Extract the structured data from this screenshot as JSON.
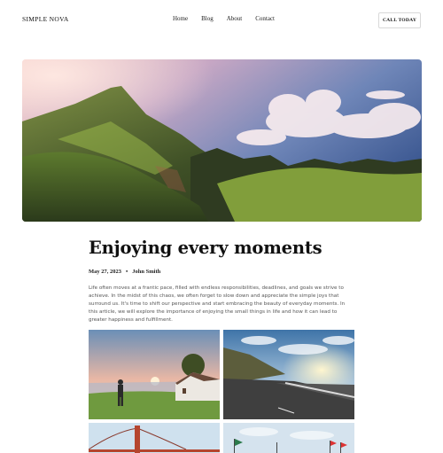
{
  "header": {
    "brand": "SIMPLE NOVA",
    "nav": [
      "Home",
      "Blog",
      "About",
      "Contact"
    ],
    "cta": "CALL TODAY"
  },
  "hero": {
    "image": "mountain-valley-sunset-photo"
  },
  "article": {
    "title": "Enjoying every moments",
    "date": "May 27, 2023",
    "separator": "•",
    "author": "John Smith",
    "body": "Life often moves at a frantic pace, filled with endless responsibilities, deadlines, and goals we strive to achieve. In the midst of this chaos, we often forget to slow down and appreciate the simple joys that surround us. It's time to shift our perspective and start embracing the beauty of everyday moments. In this article, we will explore the importance of enjoying the small things in life and how it can lead to greater happiness and fulfillment."
  },
  "gallery": [
    {
      "image": "person-at-countryside-sunset-photo"
    },
    {
      "image": "coastal-road-sunset-photo"
    },
    {
      "image": "golden-gate-bridge-photo"
    },
    {
      "image": "beach-flags-photo"
    }
  ]
}
